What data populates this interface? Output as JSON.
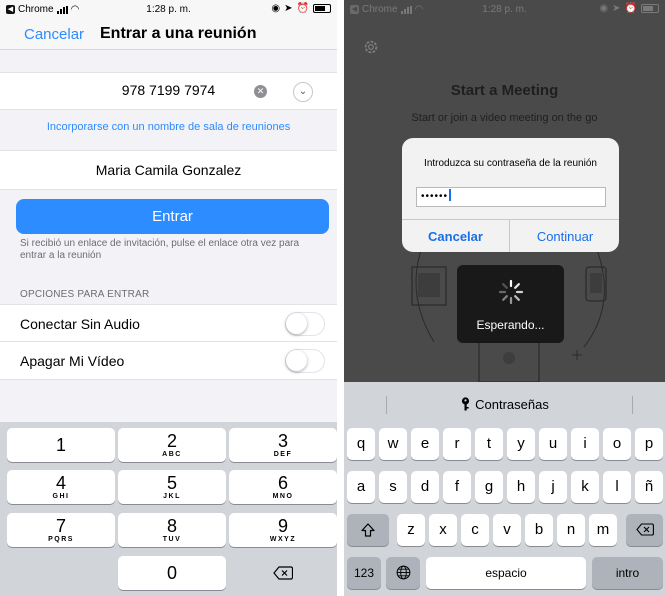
{
  "left_screen": {
    "status": {
      "app": "Chrome",
      "time": "1:28 p. m."
    },
    "nav": {
      "cancel_label": "Cancelar",
      "title": "Entrar a una reunión"
    },
    "meeting_id": "978 7199 7974",
    "join_with_room_name_link": "Incorporarse con un nombre de sala de reuniones",
    "display_name": "Maria Camila Gonzalez",
    "join_button_label": "Entrar",
    "invite_hint": "Si recibió un enlace de invitación, pulse el enlace otra vez para entrar a la reunión",
    "options_title": "OPCIONES PARA ENTRAR",
    "options": [
      {
        "label": "Conectar Sin Audio",
        "enabled": false
      },
      {
        "label": "Apagar Mi Vídeo",
        "enabled": false
      }
    ],
    "keypad": [
      {
        "num": "1",
        "letters": ""
      },
      {
        "num": "2",
        "letters": "ABC"
      },
      {
        "num": "3",
        "letters": "DEF"
      },
      {
        "num": "4",
        "letters": "GHI"
      },
      {
        "num": "5",
        "letters": "JKL"
      },
      {
        "num": "6",
        "letters": "MNO"
      },
      {
        "num": "7",
        "letters": "PQRS"
      },
      {
        "num": "8",
        "letters": "TUV"
      },
      {
        "num": "9",
        "letters": "WXYZ"
      },
      {
        "num": "0",
        "letters": ""
      }
    ]
  },
  "right_screen": {
    "status": {
      "app": "Chrome",
      "time": "1:28 p. m."
    },
    "background": {
      "title": "Start a Meeting",
      "subtitle": "Start or join a video meeting on the go"
    },
    "dialog": {
      "message": "Introduzca su contraseña de la reunión",
      "password_mask": "••••••",
      "cancel_label": "Cancelar",
      "continue_label": "Continuar"
    },
    "waiting_label": "Esperando...",
    "keyboard": {
      "suggestion_label": "Contraseñas",
      "row1": [
        "q",
        "w",
        "e",
        "r",
        "t",
        "y",
        "u",
        "i",
        "o",
        "p"
      ],
      "row2": [
        "a",
        "s",
        "d",
        "f",
        "g",
        "h",
        "j",
        "k",
        "l",
        "ñ"
      ],
      "row3": [
        "z",
        "x",
        "c",
        "v",
        "b",
        "n",
        "m"
      ],
      "numbers_label": "123",
      "space_label": "espacio",
      "return_label": "intro"
    }
  },
  "colors": {
    "accent": "#2d8cff",
    "dialog_blue": "#1a6fe6",
    "keyboard_bg": "#d1d4d9"
  }
}
